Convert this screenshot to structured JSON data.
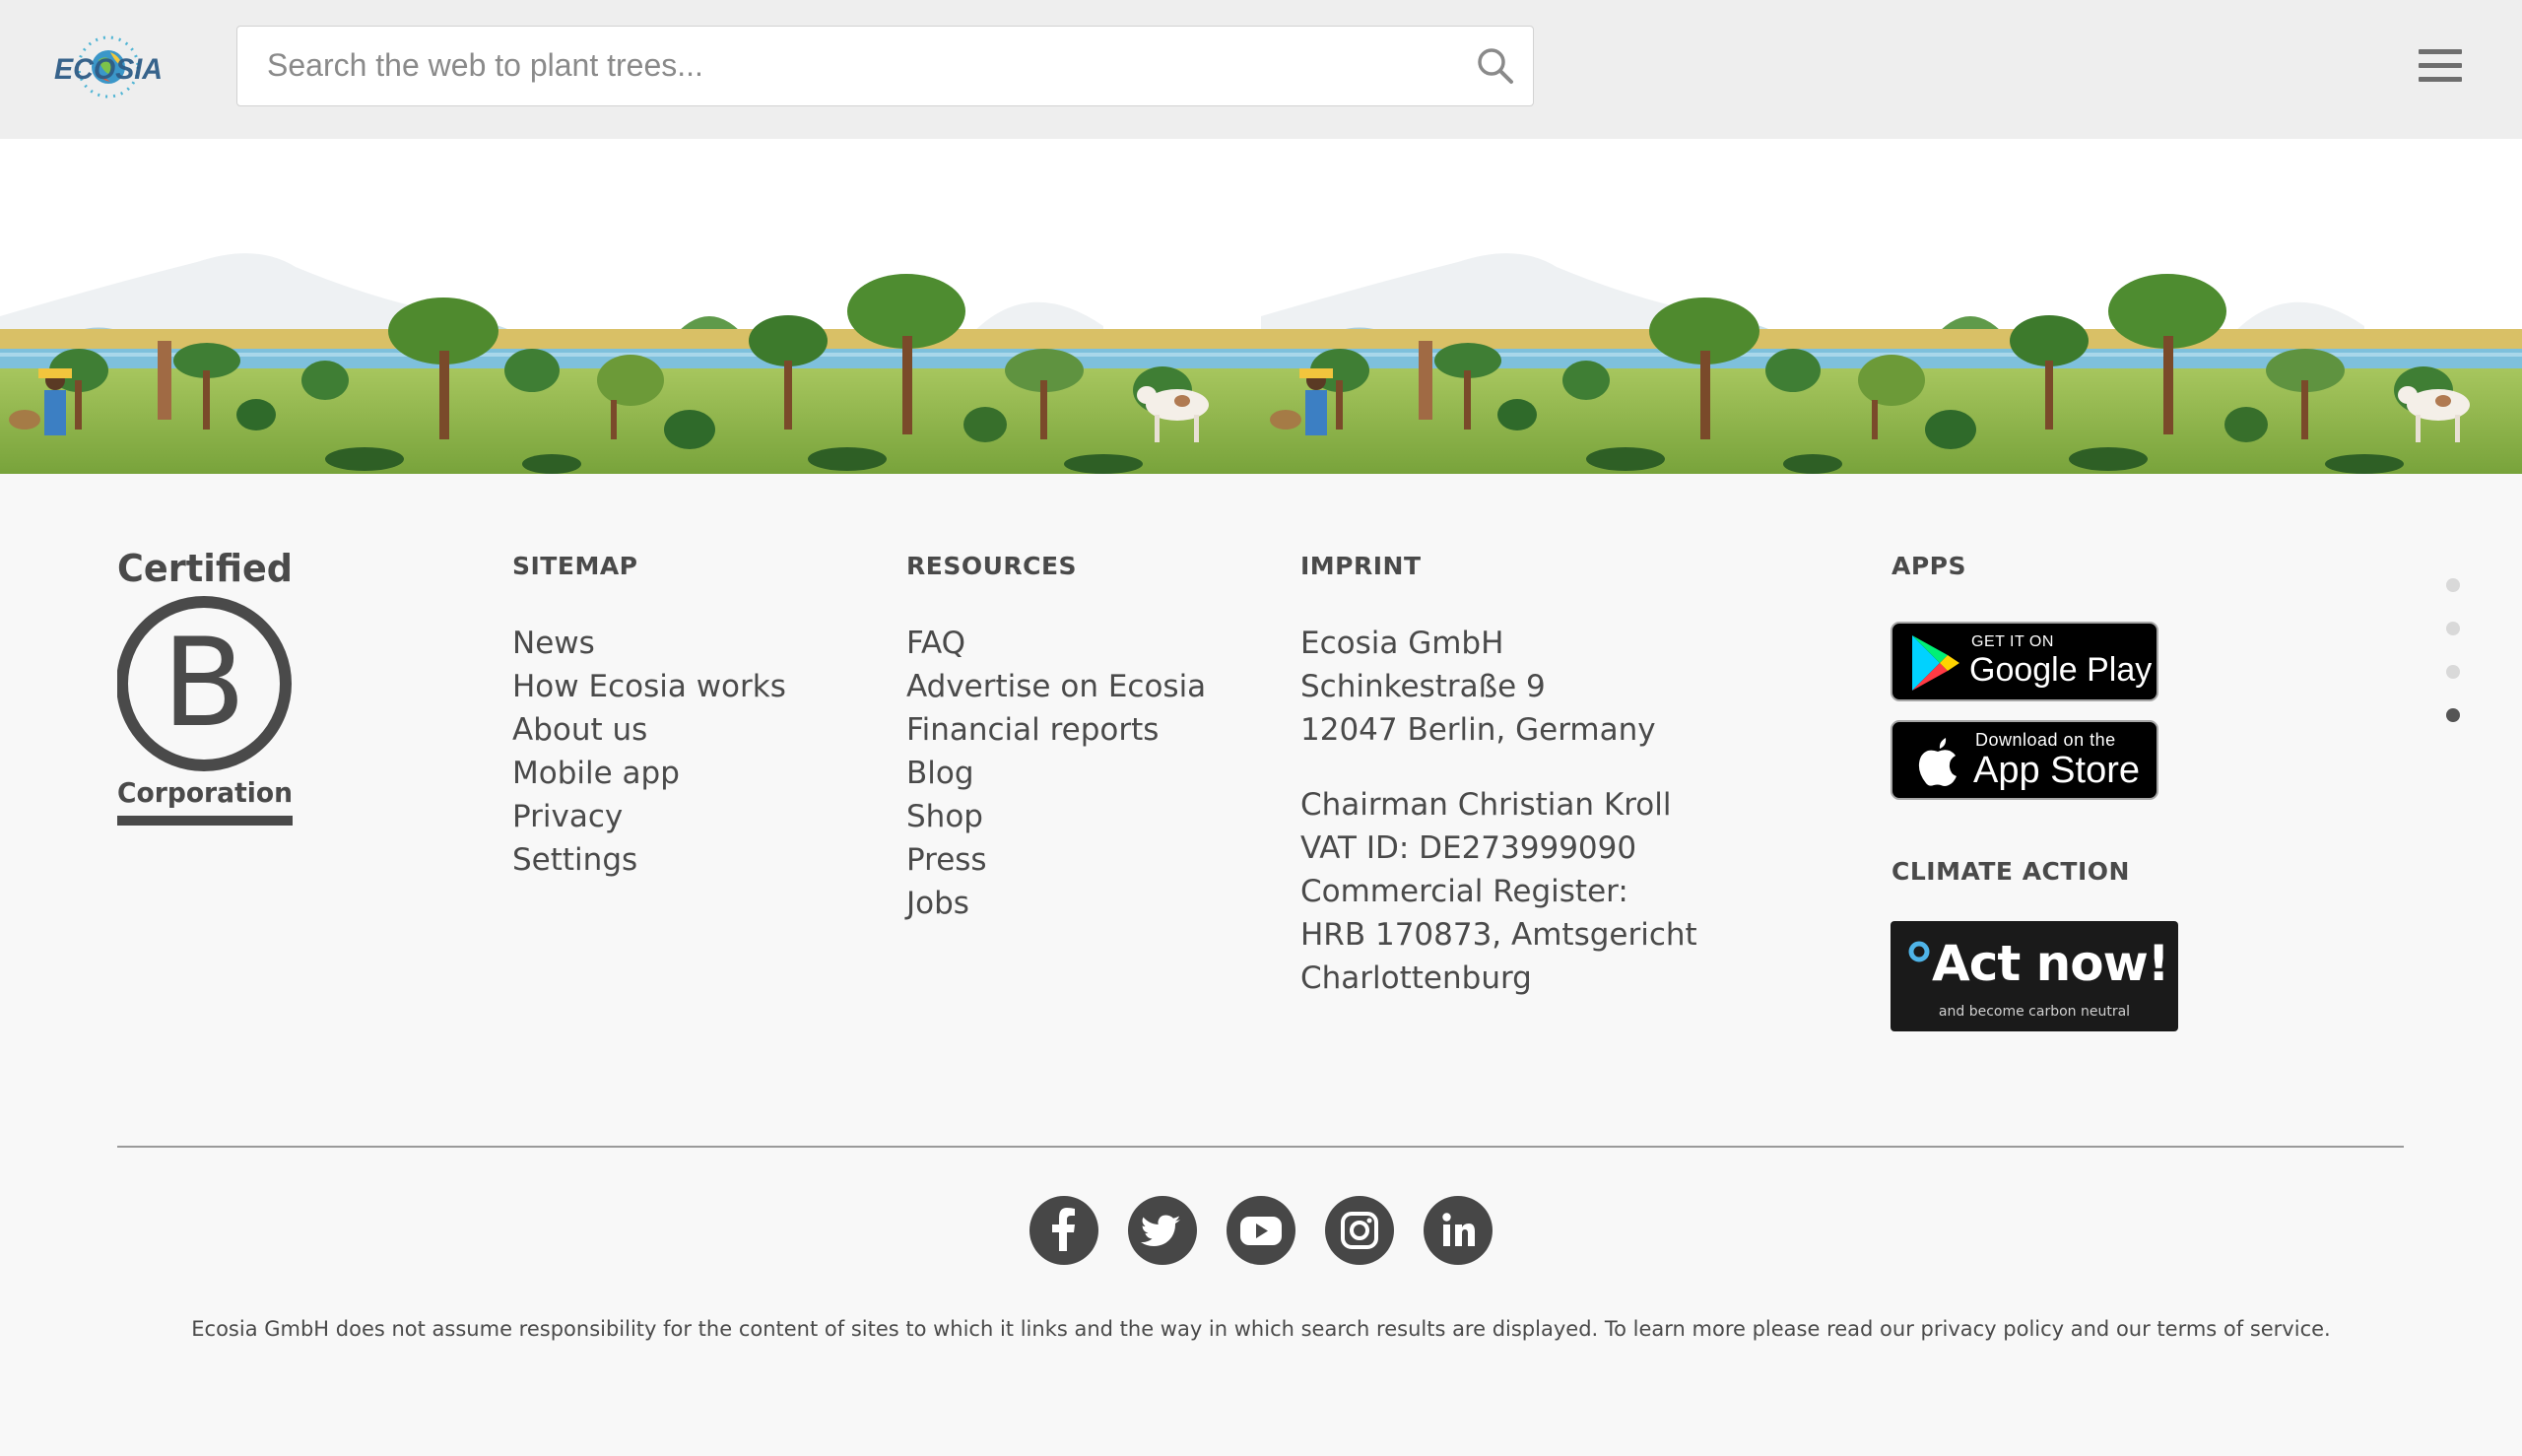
{
  "header": {
    "logo_text": "ECOSIA",
    "search_placeholder": "Search the web to plant trees..."
  },
  "footer": {
    "bcorp": {
      "top_text": "Certified",
      "letter": "B",
      "bottom_text": "Corporation"
    },
    "sitemap": {
      "heading": "SITEMAP",
      "items": [
        "News",
        "How Ecosia works",
        "About us",
        "Mobile app",
        "Privacy",
        "Settings"
      ]
    },
    "resources": {
      "heading": "RESOURCES",
      "items": [
        "FAQ",
        "Advertise on Ecosia",
        "Financial reports",
        "Blog",
        "Shop",
        "Press",
        "Jobs"
      ]
    },
    "imprint": {
      "heading": "IMPRINT",
      "address": [
        "Ecosia GmbH",
        "Schinkestraße 9",
        "12047 Berlin, Germany"
      ],
      "company": [
        "Chairman Christian Kroll",
        "VAT ID: DE273999090",
        "Commercial Register:",
        "HRB 170873, Amtsgericht",
        "Charlottenburg"
      ]
    },
    "apps": {
      "heading": "APPS",
      "google_play": {
        "small": "GET IT ON",
        "big": "Google Play"
      },
      "app_store": {
        "small": "Download on the",
        "big": "App Store"
      }
    },
    "climate_action": {
      "heading": "CLIMATE ACTION",
      "badge_title": "Act now!",
      "badge_subtitle": "and become carbon neutral"
    },
    "social": [
      "facebook",
      "twitter",
      "youtube",
      "instagram",
      "linkedin"
    ],
    "disclaimer": "Ecosia GmbH does not assume responsibility for the content of sites to which it links and the way in which search results are displayed. To learn more please read our privacy policy and our terms of service."
  },
  "page_dots": {
    "count": 4,
    "active_index": 3
  },
  "colors": {
    "header_bg": "#eeeeee",
    "footer_bg": "#f8f8f8",
    "text": "#4a4a4a",
    "social_bg": "#474747"
  }
}
